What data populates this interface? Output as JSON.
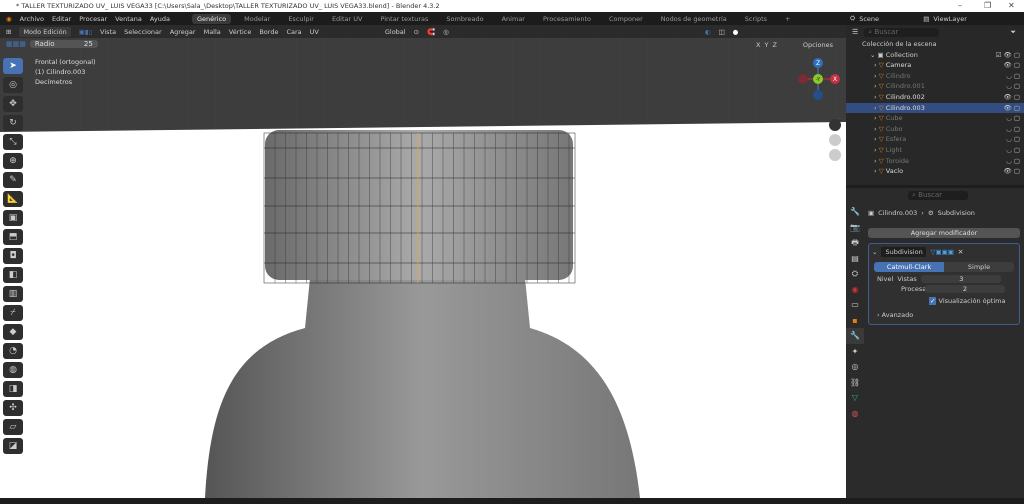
{
  "title": "* TALLER TEXTURIZADO UV_ LUIS VEGA33 [C:\\Users\\Sala_\\Desktop\\TALLER TEXTURIZADO UV_ LUIS VEGA33.blend] - Blender 4.3.2",
  "menu": [
    "Archivo",
    "Editar",
    "Procesar",
    "Ventana",
    "Ayuda"
  ],
  "workspaces": [
    "Genérico",
    "Modelar",
    "Esculpir",
    "Editar UV",
    "Pintar texturas",
    "Sombreado",
    "Animar",
    "Procesamiento",
    "Componer",
    "Nodos de geometría",
    "Scripts",
    "+"
  ],
  "header": {
    "mode": "Modo Edición",
    "menus": [
      "Vista",
      "Seleccionar",
      "Agregar",
      "Malla",
      "Vértice",
      "Borde",
      "Cara",
      "UV"
    ],
    "orientation": "Global",
    "options": "Opciones",
    "axes": [
      "X",
      "Y",
      "Z"
    ]
  },
  "tool_settings": {
    "radius_label": "Radio",
    "radius_value": "25"
  },
  "overlay": {
    "view": "Frontal (ortogonal)",
    "object": "(1) Cilindro.003",
    "units": "Decímetros"
  },
  "gizmo": {
    "z": "Z",
    "y": "-Y",
    "x": "X"
  },
  "scene": {
    "scene": "Scene",
    "view_layer": "ViewLayer",
    "search": "Buscar"
  },
  "outliner": {
    "root": "Colección de la escena",
    "collection": "Collection",
    "items": [
      {
        "name": "Camera",
        "active": true
      },
      {
        "name": "Cilindro",
        "active": false
      },
      {
        "name": "Cilindro.001",
        "active": false
      },
      {
        "name": "Cilindro.002",
        "active": true
      },
      {
        "name": "Cilindro.003",
        "active": true,
        "selected": true
      },
      {
        "name": "Cube",
        "active": false
      },
      {
        "name": "Cubo",
        "active": false
      },
      {
        "name": "Esfera",
        "active": false
      },
      {
        "name": "Light",
        "active": false
      },
      {
        "name": "Toroide",
        "active": false
      },
      {
        "name": "Vacío",
        "active": true
      }
    ]
  },
  "properties": {
    "search": "Buscar",
    "object": "Cilindro.003",
    "modifier_crumb": "Subdivision",
    "add_modifier": "Agregar modificador",
    "modifier_name": "Subdivision",
    "catmull": "Catmull-Clark",
    "simple": "Simple",
    "level_label": "Nivel",
    "viewport_label": "Vistas",
    "viewport_value": "3",
    "render_label": "Procesar",
    "render_value": "2",
    "optimal": "Visualización óptima",
    "optimal_checked": true,
    "advanced": "Avanzado"
  },
  "colors": {
    "accent": "#4772b3",
    "selected_row": "#334d80"
  }
}
